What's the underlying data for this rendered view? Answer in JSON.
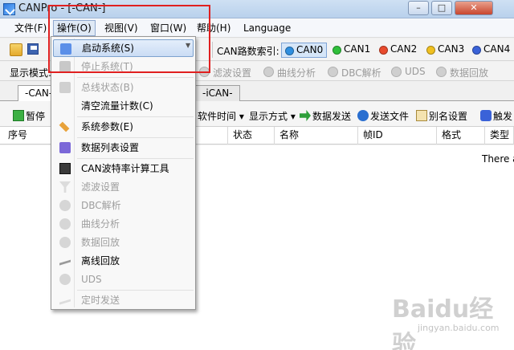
{
  "window": {
    "title": "CANPro - [-CAN-]"
  },
  "menubar": {
    "items": [
      "文件(F)",
      "操作(O)",
      "视图(V)",
      "窗口(W)",
      "帮助(H)",
      "Language"
    ]
  },
  "toolbar": {
    "can_index_label": "CAN路数索引:",
    "channels": [
      {
        "label": "CAN0",
        "color": "#2f8fe0"
      },
      {
        "label": "CAN1",
        "color": "#2fbf3a"
      },
      {
        "label": "CAN2",
        "color": "#e84a2c"
      },
      {
        "label": "CAN3",
        "color": "#f0c020"
      },
      {
        "label": "CAN4",
        "color": "#3a62d8"
      }
    ],
    "display_mode_label": "显示模式:",
    "secondary": [
      "滤波设置",
      "曲线分析",
      "DBC解析",
      "UDS",
      "数据回放"
    ]
  },
  "tabs": [
    "-CAN-",
    "-iCAN-"
  ],
  "action_bar": {
    "pause": "暂停",
    "software_time": "软件时间",
    "display_mode": "显示方式",
    "data_send": "数据发送",
    "send_file": "发送文件",
    "alias": "别名设置",
    "trigger": "触发"
  },
  "grid": {
    "columns": [
      "序号",
      "状态",
      "名称",
      "帧ID",
      "格式",
      "类型"
    ],
    "note": "There a"
  },
  "dropdown": {
    "items": [
      {
        "label": "启动系统(S)",
        "state": "highlighted",
        "icon": "start-system-icon"
      },
      {
        "label": "停止系统(T)",
        "state": "disabled",
        "icon": "stop-system-icon"
      },
      {
        "label": "总线状态(B)",
        "state": "disabled",
        "icon": "bus-status-icon"
      },
      {
        "label": "清空流量计数(C)",
        "state": "normal",
        "icon": "clear-counter-icon"
      },
      {
        "label": "系统参数(E)",
        "state": "normal",
        "icon": "wrench-icon"
      },
      {
        "label": "数据列表设置",
        "state": "normal",
        "icon": "data-list-icon"
      },
      {
        "label": "CAN波特率计算工具",
        "state": "normal",
        "icon": "calculator-icon"
      },
      {
        "label": "滤波设置",
        "state": "disabled",
        "icon": "filter-icon"
      },
      {
        "label": "DBC解析",
        "state": "disabled",
        "icon": "dbc-icon"
      },
      {
        "label": "曲线分析",
        "state": "disabled",
        "icon": "curve-icon"
      },
      {
        "label": "数据回放",
        "state": "disabled",
        "icon": "playback-icon"
      },
      {
        "label": "离线回放",
        "state": "normal",
        "icon": "offline-playback-icon"
      },
      {
        "label": "UDS",
        "state": "disabled",
        "icon": "uds-icon"
      },
      {
        "label": "定时发送",
        "state": "disabled",
        "icon": "timer-send-icon"
      }
    ]
  },
  "watermark": {
    "brand": "Baidu经验",
    "url": "jingyan.baidu.com"
  }
}
